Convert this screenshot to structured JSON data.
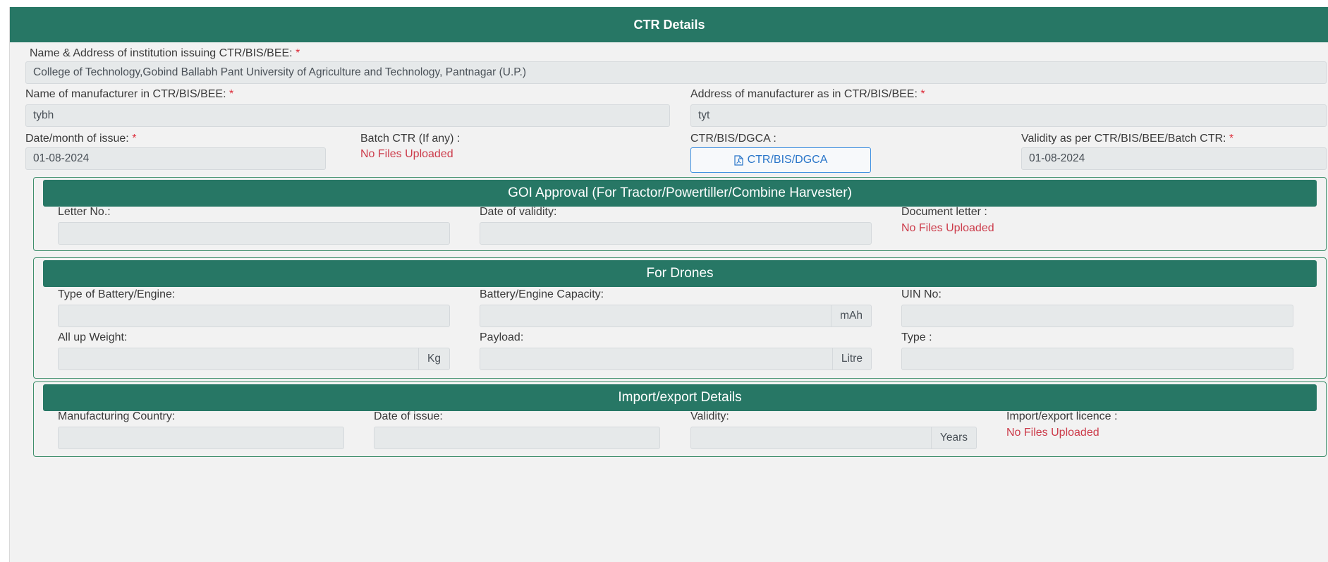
{
  "ctr": {
    "title": "CTR Details",
    "institution_label": "Name & Address of institution issuing CTR/BIS/BEE:",
    "institution_value": "College of Technology,Gobind Ballabh Pant University of Agriculture and Technology, Pantnagar (U.P.)",
    "manufacturer_name_label": "Name of manufacturer in CTR/BIS/BEE:",
    "manufacturer_name_value": "tybh",
    "manufacturer_address_label": "Address of manufacturer as in CTR/BIS/BEE:",
    "manufacturer_address_value": "tyt",
    "issue_date_label": "Date/month of issue:",
    "issue_date_value": "01-08-2024",
    "batch_ctr_label": "Batch CTR (If any) :",
    "batch_ctr_status": "No Files Uploaded",
    "ctr_doc_label": "CTR/BIS/DGCA :",
    "ctr_doc_button": "CTR/BIS/DGCA",
    "validity_label": "Validity as per CTR/BIS/BEE/Batch CTR:",
    "validity_value": "01-08-2024",
    "required_mark": "*"
  },
  "goi": {
    "title": "GOI Approval (For Tractor/Powertiller/Combine Harvester)",
    "letter_no_label": "Letter No.:",
    "letter_no_value": "",
    "date_validity_label": "Date of validity:",
    "date_validity_value": "",
    "document_letter_label": "Document letter :",
    "document_letter_status": "No Files Uploaded"
  },
  "drones": {
    "title": "For Drones",
    "battery_type_label": "Type of Battery/Engine:",
    "battery_capacity_label": "Battery/Engine Capacity:",
    "battery_capacity_unit": "mAh",
    "uin_label": "UIN No:",
    "weight_label": "All up Weight:",
    "weight_unit": "Kg",
    "payload_label": "Payload:",
    "payload_unit": "Litre",
    "type_label": "Type :"
  },
  "import_export": {
    "title": "Import/export Details",
    "country_label": "Manufacturing Country:",
    "date_issue_label": "Date of issue:",
    "validity_label": "Validity:",
    "validity_unit": "Years",
    "licence_label": "Import/export licence :",
    "licence_status": "No Files Uploaded"
  },
  "icons": {
    "document": "file-pdf-icon"
  },
  "colors": {
    "header": "#277765",
    "required": "#dd2f3c",
    "link": "#2a76c9",
    "panel": "#f2f2f2"
  }
}
